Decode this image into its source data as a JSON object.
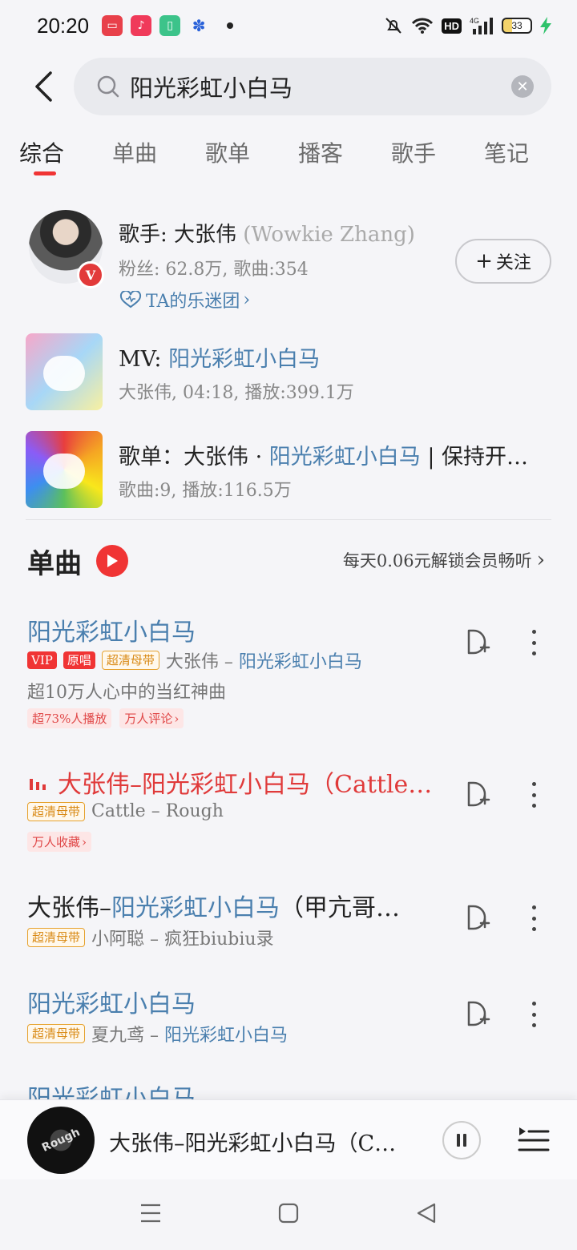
{
  "status_bar": {
    "time": "20:20",
    "battery": "33",
    "network": "4G",
    "hd": "HD",
    "app_icons": [
      "video-app-icon",
      "music-app-icon",
      "battery-app-icon",
      "baidu-app-icon"
    ]
  },
  "search": {
    "query": "阳光彩虹小白马"
  },
  "tabs": [
    {
      "label": "综合",
      "active": true
    },
    {
      "label": "单曲"
    },
    {
      "label": "歌单"
    },
    {
      "label": "播客"
    },
    {
      "label": "歌手"
    },
    {
      "label": "笔记"
    }
  ],
  "artist": {
    "title_prefix": "歌手: 大张伟",
    "title_en": "(Wowkie Zhang)",
    "meta": "粉丝: 62.8万, 歌曲:354",
    "fanclub": "TA的乐迷团",
    "badge": "V",
    "follow": "关注"
  },
  "mv": {
    "label_prefix": "MV: ",
    "label_hl": "阳光彩虹小白马",
    "sub": "大张伟, 04:18, 播放:399.1万"
  },
  "playlist": {
    "label_prefix": "歌单：大张伟 · ",
    "label_hl": "阳光彩虹小白马",
    "label_suffix": " | 保持开…",
    "sub": "歌曲:9, 播放:116.5万"
  },
  "singles": {
    "title": "单曲",
    "promo": "每天0.06元解锁会员畅听"
  },
  "songs": [
    {
      "title_hl": "阳光彩虹小白马",
      "tags": [
        "VIP",
        "原唱",
        "超清母带"
      ],
      "artist": "大张伟",
      "sep": " – ",
      "album_hl": "阳光彩虹小白马",
      "desc": "超10万人心中的当红神曲",
      "pills": [
        "超73%人播放",
        "万人评论"
      ]
    },
    {
      "title": "大张伟–阳光彩虹小白马（Cattle…",
      "tags": [
        "超清母带"
      ],
      "artist": "Cattle – Rough",
      "pills": [
        "万人收藏"
      ]
    },
    {
      "title_prefix": "大张伟–",
      "title_hl": "阳光彩虹小白马",
      "title_suffix": "（甲亢哥…",
      "tags": [
        "超清母带"
      ],
      "artist": "小阿聪 – 疯狂biubiu录"
    },
    {
      "title_hl": "阳光彩虹小白马",
      "tags": [
        "超清母带"
      ],
      "artist": "夏九鸢",
      "sep": " – ",
      "album_hl": "阳光彩虹小白马"
    },
    {
      "title_hl": "阳光彩虹小白马"
    }
  ],
  "mini_player": {
    "title": "大张伟–阳光彩虹小白马（C…",
    "disc_label": "Rough"
  },
  "colors": {
    "accent_red": "#f03434",
    "link_blue": "#4a7fae",
    "gold_tag": "#d98a16"
  }
}
